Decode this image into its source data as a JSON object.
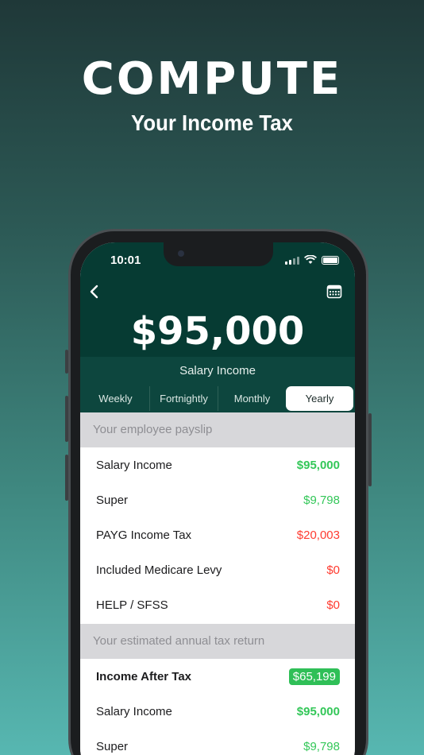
{
  "promo": {
    "headline": "COMPUTE",
    "subline": "Your Income Tax"
  },
  "status_bar": {
    "time": "10:01"
  },
  "header": {
    "amount": "$95,000",
    "subtitle": "Salary Income",
    "icons": [
      "chevron-left-icon",
      "calendar-icon"
    ]
  },
  "tabs": [
    {
      "label": "Weekly",
      "active": false
    },
    {
      "label": "Fortnightly",
      "active": false
    },
    {
      "label": "Monthly",
      "active": false
    },
    {
      "label": "Yearly",
      "active": true
    }
  ],
  "payslip": {
    "title": "Your employee payslip",
    "rows": [
      {
        "label": "Salary Income",
        "value": "$95,000"
      },
      {
        "label": "Super",
        "value": "$9,798"
      },
      {
        "label": "PAYG Income Tax",
        "value": "$20,003"
      },
      {
        "label": "Included Medicare Levy",
        "value": "$0"
      },
      {
        "label": "HELP / SFSS",
        "value": "$0"
      }
    ]
  },
  "tax_return": {
    "title": "Your estimated annual tax return",
    "rows": [
      {
        "label": "Income After Tax",
        "value": "$65,199"
      },
      {
        "label": "Salary Income",
        "value": "$95,000"
      },
      {
        "label": "Super",
        "value": "$9,798"
      }
    ]
  },
  "colors": {
    "header_bg": "#063b33",
    "positive": "#34c759",
    "negative": "#ff3b30",
    "badge": "#2fbf57"
  }
}
